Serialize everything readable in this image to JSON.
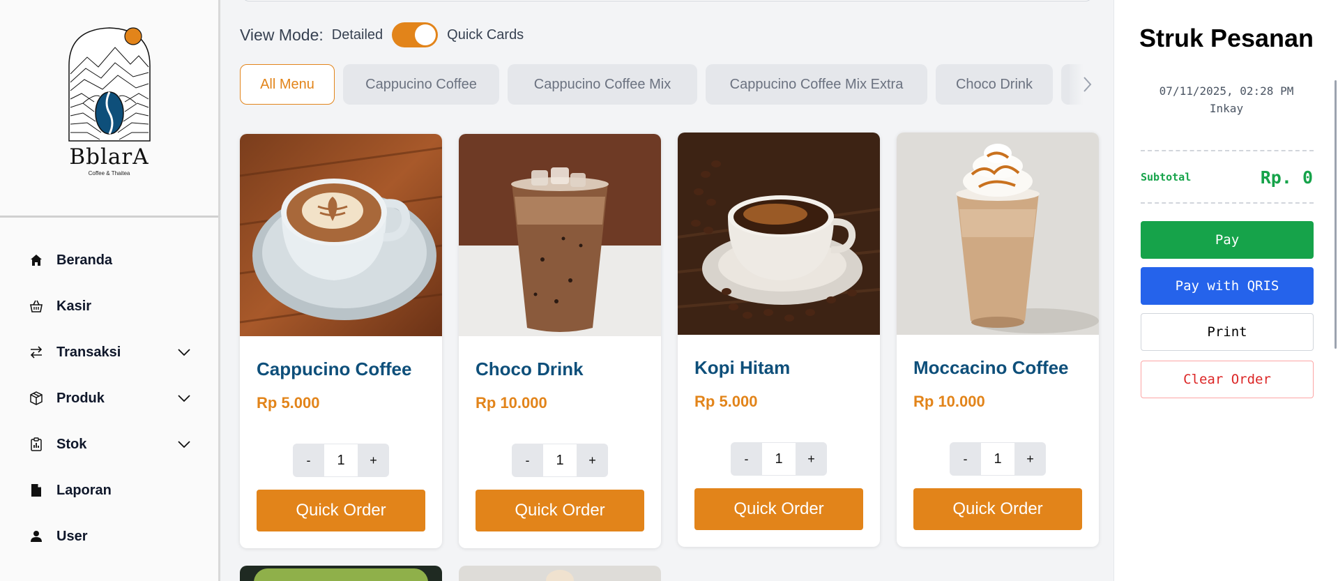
{
  "brand": {
    "name": "BblarA",
    "tagline": "Coffee & Thaitea"
  },
  "sidebar": {
    "items": [
      {
        "label": "Beranda",
        "icon": "home-icon",
        "expandable": false
      },
      {
        "label": "Kasir",
        "icon": "basket-icon",
        "expandable": false
      },
      {
        "label": "Transaksi",
        "icon": "arrows-swap-icon",
        "expandable": true
      },
      {
        "label": "Produk",
        "icon": "box-icon",
        "expandable": true
      },
      {
        "label": "Stok",
        "icon": "clipboard-chart-icon",
        "expandable": true
      },
      {
        "label": "Laporan",
        "icon": "document-icon",
        "expandable": false
      },
      {
        "label": "User",
        "icon": "user-icon",
        "expandable": false
      }
    ]
  },
  "view_mode": {
    "label": "View Mode:",
    "left_option": "Detailed",
    "right_option": "Quick Cards",
    "quick_cards_on": true
  },
  "categories": [
    "All Menu",
    "Cappucino Coffee",
    "Cappucino Coffee Mix",
    "Cappucino Coffee Mix Extra",
    "Choco Drink"
  ],
  "active_category": "All Menu",
  "products": [
    {
      "name": "Cappucino Coffee",
      "price": "Rp 5.000",
      "qty": "1",
      "button": "Quick Order",
      "qty_minus": "-",
      "qty_plus": "+"
    },
    {
      "name": "Choco Drink",
      "price": "Rp 10.000",
      "qty": "1",
      "button": "Quick Order",
      "qty_minus": "-",
      "qty_plus": "+"
    },
    {
      "name": "Kopi Hitam",
      "price": "Rp 5.000",
      "qty": "1",
      "button": "Quick Order",
      "qty_minus": "-",
      "qty_plus": "+"
    },
    {
      "name": "Moccacino Coffee",
      "price": "Rp 10.000",
      "qty": "1",
      "button": "Quick Order",
      "qty_minus": "-",
      "qty_plus": "+"
    }
  ],
  "receipt": {
    "title": "Struk Pesanan",
    "datetime": "07/11/2025, 02:28 PM",
    "cashier": "Inkay",
    "subtotal_label": "Subtotal",
    "subtotal_value": "Rp. 0",
    "pay_label": "Pay",
    "qris_label": "Pay with QRIS",
    "print_label": "Print",
    "clear_label": "Clear Order"
  },
  "colors": {
    "accent": "#e2841a",
    "title_blue": "#0e4f7a",
    "pay_green": "#16a34a",
    "qris_blue": "#2563eb",
    "clear_red": "#dc2626"
  }
}
